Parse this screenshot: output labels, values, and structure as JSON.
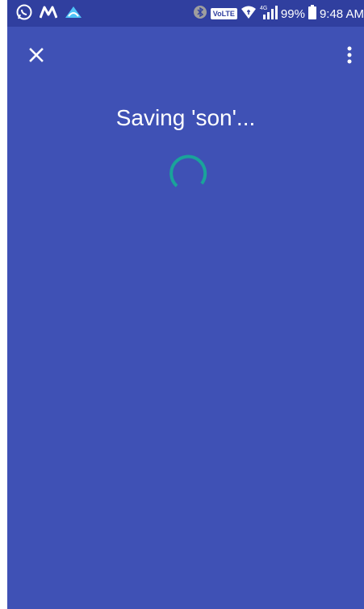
{
  "status_bar": {
    "battery_percent": "99%",
    "time": "9:48 AM",
    "network_label": "VoLTE",
    "network_type": "4G",
    "icons": [
      "whatsapp-icon",
      "m-app-icon",
      "cloud-app-icon",
      "bluetooth-icon",
      "volte-icon",
      "wifi-icon",
      "signal-icon",
      "battery-icon"
    ]
  },
  "toolbar": {
    "close_icon": "close-icon",
    "menu_icon": "more-vert-icon"
  },
  "main": {
    "title": "Saving 'son'...",
    "spinner_icon": "loading-spinner"
  },
  "colors": {
    "background": "#3f51b5",
    "status_bar": "#303f9f",
    "spinner": "#1aa39a"
  }
}
